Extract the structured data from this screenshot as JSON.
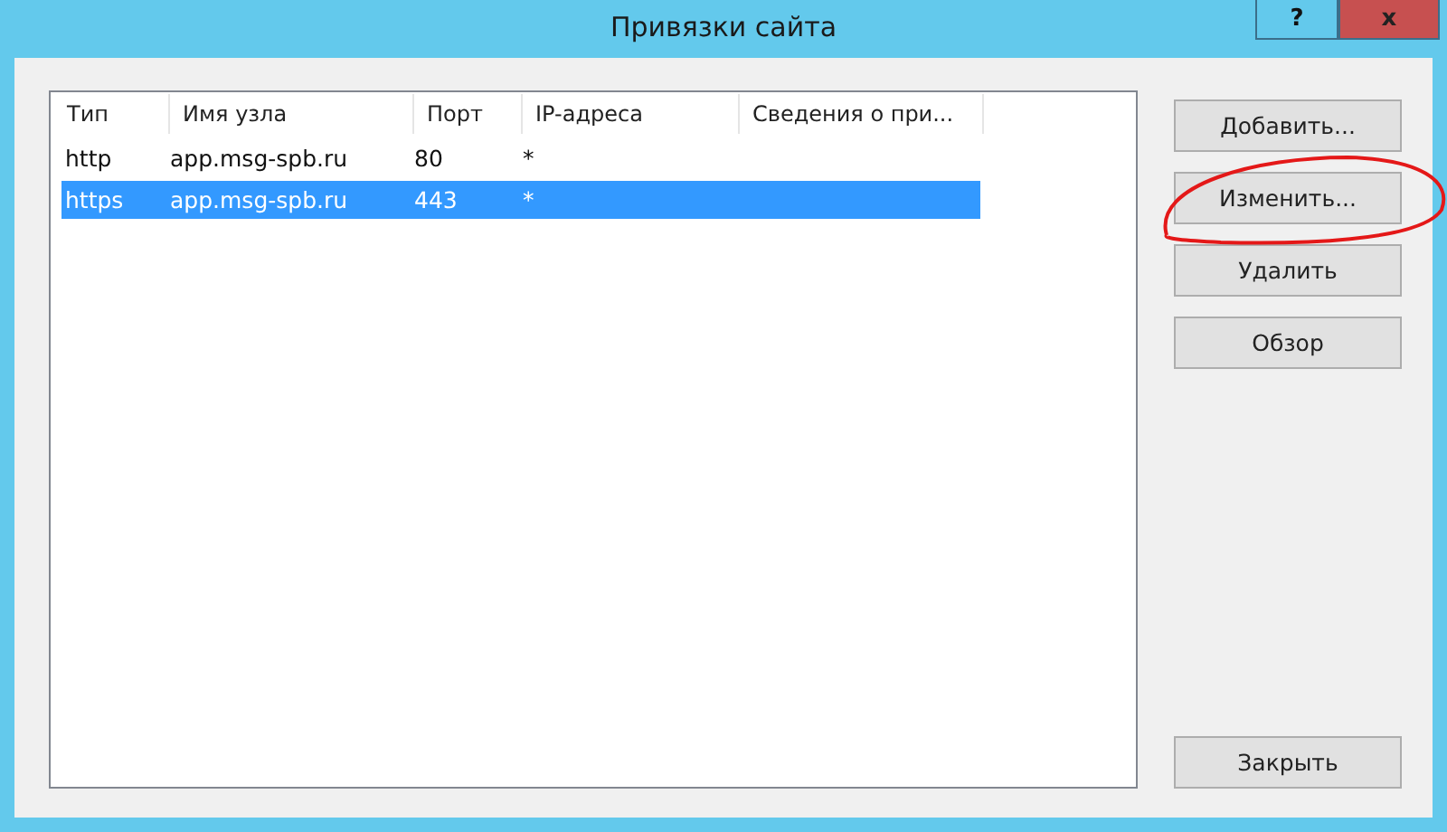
{
  "window": {
    "title": "Привязки сайта",
    "help_label": "?",
    "close_label": "x"
  },
  "table": {
    "columns": [
      "Тип",
      "Имя узла",
      "Порт",
      "IP-адреса",
      "Сведения о при..."
    ],
    "rows": [
      {
        "cells": [
          "http",
          "app.msg-spb.ru",
          "80",
          "*"
        ],
        "selected": false
      },
      {
        "cells": [
          "https",
          "app.msg-spb.ru",
          "443",
          "*"
        ],
        "selected": true
      }
    ]
  },
  "buttons": [
    "Добавить...",
    "Изменить...",
    "Удалить",
    "Обзор"
  ],
  "close_button": "Закрыть"
}
